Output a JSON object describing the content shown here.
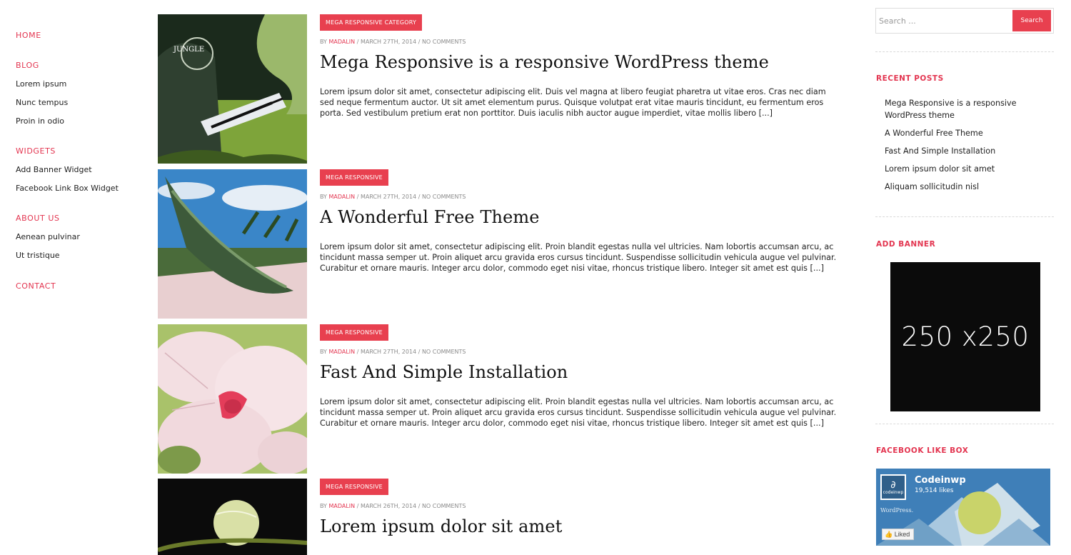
{
  "nav": {
    "home": "HOME",
    "blog": "BLOG",
    "blog_items": [
      "Lorem ipsum",
      "Nunc tempus",
      "Proin in odio"
    ],
    "widgets": "WIDGETS",
    "widget_items": [
      "Add Banner Widget",
      "Facebook Link Box Widget"
    ],
    "about": "ABOUT US",
    "about_items": [
      "Aenean pulvinar",
      "Ut tristique"
    ],
    "contact": "CONTACT"
  },
  "posts": [
    {
      "category": "MEGA RESPONSIVE CATEGORY",
      "by": "BY",
      "author": "MADALIN",
      "date_sep": " / MARCH 27TH, 2014 / ",
      "comments": "NO COMMENTS",
      "title": "Mega Responsive is a responsive WordPress theme",
      "excerpt": "Lorem ipsum dolor sit amet, consectetur adipiscing elit. Duis vel magna at libero feugiat pharetra ut vitae eros. Cras nec diam sed neque fermentum auctor. Ut sit amet elementum purus. Quisque volutpat erat vitae mauris tincidunt, eu fermentum eros porta. Sed vestibulum pretium erat non porttitor. Duis iaculis nibh auctor augue imperdiet, vitae mollis libero [...]",
      "thumb_text": "JUNGLE"
    },
    {
      "category": "MEGA RESPONSIVE",
      "by": "BY",
      "author": "MADALIN",
      "date_sep": " / MARCH 27TH, 2014 / ",
      "comments": "NO COMMENTS",
      "title": "A Wonderful Free Theme",
      "excerpt": "Lorem ipsum dolor sit amet, consectetur adipiscing elit. Proin blandit egestas nulla vel ultricies. Nam lobortis accumsan arcu, ac tincidunt massa semper ut. Proin aliquet arcu gravida eros cursus tincidunt. Suspendisse sollicitudin vehicula augue vel pulvinar. Curabitur et ornare mauris. Integer arcu dolor, commodo eget nisi vitae, rhoncus tristique libero. Integer sit amet est quis [...]"
    },
    {
      "category": "MEGA RESPONSIVE",
      "by": "BY",
      "author": "MADALIN",
      "date_sep": " / MARCH 27TH, 2014 / ",
      "comments": "NO COMMENTS",
      "title": "Fast And Simple Installation",
      "excerpt": "Lorem ipsum dolor sit amet, consectetur adipiscing elit. Proin blandit egestas nulla vel ultricies. Nam lobortis accumsan arcu, ac tincidunt massa semper ut. Proin aliquet arcu gravida eros cursus tincidunt. Suspendisse sollicitudin vehicula augue vel pulvinar. Curabitur et ornare mauris. Integer arcu dolor, commodo eget nisi vitae, rhoncus tristique libero. Integer sit amet est quis [...]"
    },
    {
      "category": "MEGA RESPONSIVE",
      "by": "BY",
      "author": "MADALIN",
      "date_sep": " / MARCH 26TH, 2014 / ",
      "comments": "NO COMMENTS",
      "title": "Lorem ipsum dolor sit amet",
      "excerpt": ""
    }
  ],
  "sidebar": {
    "search_placeholder": "Search ...",
    "search_button": "Search",
    "recent_title": "RECENT POSTS",
    "recent_posts": [
      "Mega Responsive is a responsive WordPress theme",
      "A Wonderful Free Theme",
      "Fast And Simple Installation",
      "Lorem ipsum dolor sit amet",
      "Aliquam sollicitudin nisl"
    ],
    "banner_title": "ADD BANNER",
    "banner_label": "250 x250",
    "fb_title": "FACEBOOK LIKE BOX",
    "fb_name": "Codeinwp",
    "fb_likes": "19,514 likes",
    "fb_logo_text": "codeinwp",
    "fb_tagline": "WordPress.",
    "fb_liked": "Liked"
  },
  "colors": {
    "accent": "#e8404f",
    "text": "#222222",
    "meta": "#8a8a8a"
  }
}
